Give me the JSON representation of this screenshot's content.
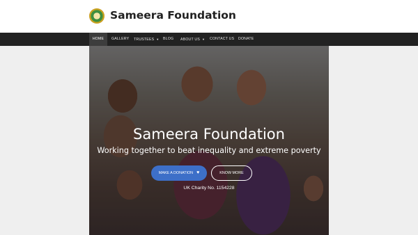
{
  "site": {
    "title": "Sameera Foundation"
  },
  "nav": {
    "items": [
      {
        "label": "HOME",
        "active": true
      },
      {
        "label": "GALLERY"
      },
      {
        "label": "TRUSTEES",
        "icon": "chevron-down-icon"
      },
      {
        "label": "BLOG"
      },
      {
        "label": "ABOUT US",
        "icon": "chevron-down-icon"
      },
      {
        "label": "CONTACT US"
      },
      {
        "label": "DONATE"
      }
    ]
  },
  "hero": {
    "title": "Sameera Foundation",
    "subtitle": "Working together to beat inequality and extreme poverty",
    "donate_button": "MAKE A DONATION",
    "donate_icon": "heart-icon",
    "know_more_button": "KNOW MORE",
    "charity_text": "UK Charity No. 1154228"
  },
  "colors": {
    "nav_background": "#222222",
    "button_primary": "#3d6fc8",
    "page_background": "#efefef"
  }
}
